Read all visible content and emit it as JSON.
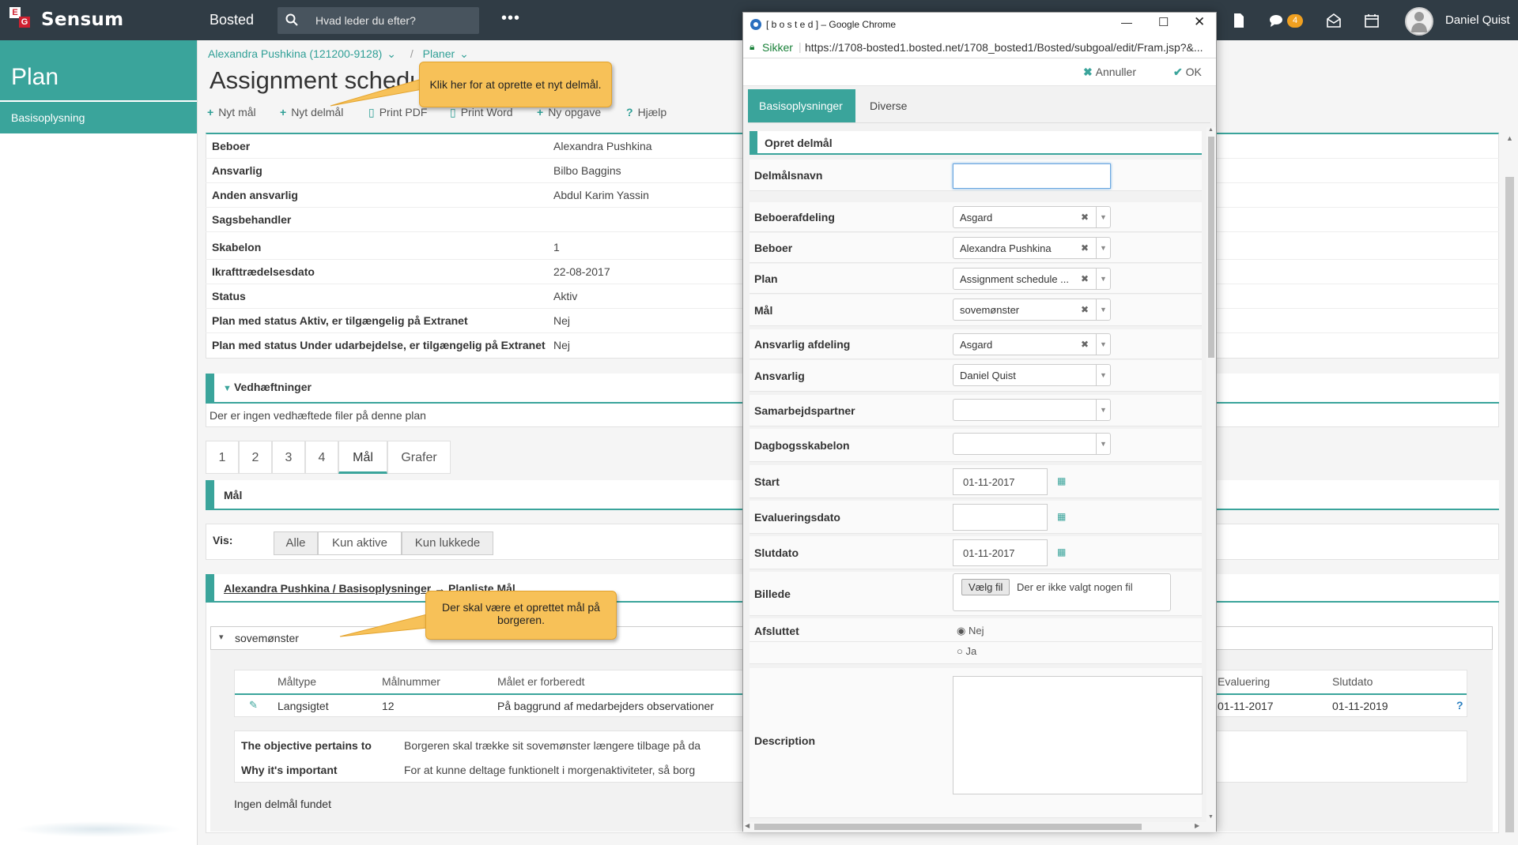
{
  "topbar": {
    "brand": "Sensum",
    "logo_letters": [
      "E",
      "G"
    ],
    "module": "Bosted",
    "search_placeholder": "Hvad leder du efter?",
    "more": "•••",
    "notification_count": "4",
    "username": "Daniel Quist",
    "icons": [
      "document-icon",
      "chat-icon",
      "inbox-icon",
      "calendar-icon",
      "user-avatar-icon"
    ]
  },
  "sidebar": {
    "title": "Plan",
    "items": [
      {
        "label": "Basisoplysning"
      }
    ]
  },
  "breadcrumb": {
    "person": "Alexandra Pushkina (121200-9128)",
    "separator": "/",
    "section": "Planer"
  },
  "page": {
    "title": "Assignment schedu"
  },
  "toolbar": {
    "new_goal": "Nyt mål",
    "new_subgoal": "Nyt delmål",
    "print_pdf": "Print PDF",
    "print_word": "Print Word",
    "new_task": "Ny opgave",
    "help": "Hjælp"
  },
  "info": {
    "rows": [
      {
        "label": "Beboer",
        "value": "Alexandra Pushkina"
      },
      {
        "label": "Ansvarlig",
        "value": "Bilbo Baggins"
      },
      {
        "label": "Anden ansvarlig",
        "value": "Abdul Karim Yassin"
      },
      {
        "label": "Sagsbehandler",
        "value": ""
      },
      {
        "label": "Skabelon",
        "value": "1"
      },
      {
        "label": "Ikrafttrædelsesdato",
        "value": "22-08-2017"
      },
      {
        "label": "Status",
        "value": "Aktiv"
      },
      {
        "label": "Plan med status Aktiv, er tilgængelig på Extranet",
        "value": "Nej"
      },
      {
        "label": "Plan med status Under udarbejdelse, er tilgængelig på Extranet",
        "value": "Nej"
      }
    ]
  },
  "attachments": {
    "title": "Vedhæftninger",
    "empty": "Der er ingen vedhæftede filer på denne plan"
  },
  "tabs": [
    "1",
    "2",
    "3",
    "4",
    "Mål",
    "Grafer"
  ],
  "goals": {
    "title": "Mål",
    "show_label": "Vis:",
    "filters": [
      "Alle",
      "Kun aktive",
      "Kun lukkede"
    ],
    "list_title": "Alexandra Pushkina / Basisoplysninger → Planliste Mål",
    "goal_name": "sovemønster",
    "columns": [
      "Måltype",
      "Målnummer",
      "Målet er forberedt",
      "Evaluering",
      "Slutdato"
    ],
    "row": {
      "type": "Langsigtet",
      "number": "12",
      "prepared": "På baggrund af medarbejders observationer",
      "evaluation": "01-11-2017",
      "end": "01-11-2019",
      "help": "?"
    },
    "details": [
      {
        "label": "The objective pertains to",
        "value": "Borgeren skal trække sit sovemønster længere tilbage på da"
      },
      {
        "label": "Why it's important",
        "value": "For at kunne deltage funktionelt i morgenaktiviteter, så borg"
      }
    ],
    "no_subgoals": "Ingen delmål fundet"
  },
  "callouts": {
    "top": "Klik her for at oprette et nyt delmål.",
    "bottom": "Der skal være et oprettet mål på borgeren."
  },
  "popup": {
    "window_title": "[ b o s t e d ] – Google Chrome",
    "secure_label": "Sikker",
    "url": "https://1708-bosted1.bosted.net/1708_bosted1/Bosted/subgoal/edit/Fram.jsp?&...",
    "cancel": "Annuller",
    "ok": "OK",
    "tabs": [
      "Basisoplysninger",
      "Diverse"
    ],
    "section_title": "Opret delmål",
    "fields": {
      "name_label": "Delmålsnavn",
      "name_value": "",
      "resident_dept_label": "Beboerafdeling",
      "resident_dept_value": "Asgard",
      "resident_label": "Beboer",
      "resident_value": "Alexandra Pushkina",
      "plan_label": "Plan",
      "plan_value": "Assignment schedule ...",
      "goal_label": "Mål",
      "goal_value": "sovemønster",
      "resp_dept_label": "Ansvarlig afdeling",
      "resp_dept_value": "Asgard",
      "resp_label": "Ansvarlig",
      "resp_value": "Daniel Quist",
      "partner_label": "Samarbejdspartner",
      "partner_value": "",
      "diary_label": "Dagbogsskabelon",
      "diary_value": "",
      "start_label": "Start",
      "start_value": "01-11-2017",
      "eval_label": "Evalueringsdato",
      "eval_value": "",
      "end_label": "Slutdato",
      "end_value": "01-11-2017",
      "image_label": "Billede",
      "file_button": "Vælg fil",
      "file_none": "Der er ikke valgt nogen fil",
      "closed_label": "Afsluttet",
      "closed_no": "Nej",
      "closed_yes": "Ja",
      "description_label": "Description"
    }
  },
  "colors": {
    "teal": "#3aa49b",
    "topbar": "#303c45",
    "callout": "#f7c158"
  }
}
